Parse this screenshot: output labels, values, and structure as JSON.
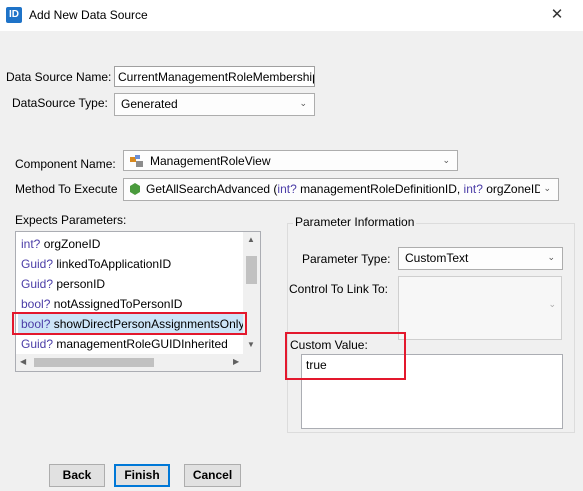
{
  "window": {
    "app_icon_text": "ID",
    "title": "Add New Data Source",
    "close_glyph": "✕"
  },
  "datasource": {
    "name_label": "Data Source Name:",
    "name_value": "CurrentManagementRoleMembership",
    "type_label": "DataSource Type:",
    "type_value": "Generated"
  },
  "component": {
    "label": "Component Name:",
    "value": "ManagementRoleView",
    "icon": "component-icon"
  },
  "method": {
    "label": "Method To Execute",
    "icon": "method-icon",
    "name": "GetAllSearchAdvanced",
    "open_paren": " (",
    "param1_type": "int?",
    "param1_name": " managementRoleDefinitionID, ",
    "param2_type": "int?",
    "param2_name": " orgZoneID"
  },
  "parameters": {
    "label": "Expects Parameters:",
    "items": [
      {
        "type": "int?",
        "name": "orgZoneID"
      },
      {
        "type": "Guid?",
        "name": "linkedToApplicationID"
      },
      {
        "type": "Guid?",
        "name": "personID"
      },
      {
        "type": "bool?",
        "name": "notAssignedToPersonID"
      },
      {
        "type": "bool?",
        "name": "showDirectPersonAssignmentsOnly"
      },
      {
        "type": "Guid?",
        "name": "managementRoleGUIDInherited"
      }
    ],
    "selected_index": 4
  },
  "param_info": {
    "group_title": "Parameter Information",
    "type_label": "Parameter Type:",
    "type_value": "CustomText",
    "link_label": "Control To Link To:",
    "custom_label": "Custom Value:",
    "custom_value": "true"
  },
  "buttons": {
    "back": "Back",
    "finish": "Finish",
    "cancel": "Cancel"
  },
  "colors": {
    "highlight": "#e3182d",
    "type_keyword": "#4b3da7",
    "selection": "#cce4f7"
  }
}
